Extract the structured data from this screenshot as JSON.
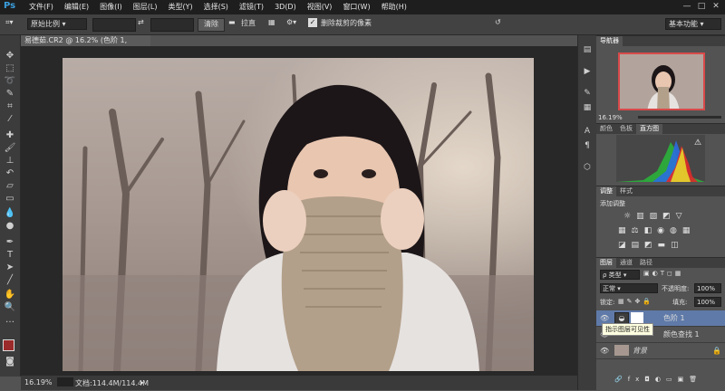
{
  "app": {
    "logo": "Ps"
  },
  "menu": [
    "文件(F)",
    "编辑(E)",
    "图像(I)",
    "图层(L)",
    "类型(Y)",
    "选择(S)",
    "滤镜(T)",
    "3D(D)",
    "视图(V)",
    "窗口(W)",
    "帮助(H)"
  ],
  "window_controls": [
    "—",
    "□",
    "✕"
  ],
  "options": {
    "ratio": "原始比例",
    "clear_button": "清除",
    "straighten": "拉直",
    "delete_cropped_label": "删除裁剪的像素",
    "workspace": "基本功能"
  },
  "document": {
    "tab_title": "易德茹.CR2 @ 16.2% (色阶 1, RGB/16) *",
    "zoom": "16.19%",
    "doc_info": "文档:114.4M/114.4M"
  },
  "navigator": {
    "tab": "导航器",
    "zoom": "16.19%"
  },
  "histogram": {
    "tabs": [
      "颜色",
      "色板",
      "直方图"
    ],
    "active": "直方图"
  },
  "adjustments": {
    "tabs": [
      "调整",
      "样式"
    ],
    "active": "调整",
    "title": "添加调整"
  },
  "layers": {
    "tabs": [
      "图层",
      "通道",
      "路径"
    ],
    "active": "图层",
    "filter_kind": "类型",
    "blend_mode": "正常",
    "opacity_label": "不透明度:",
    "opacity_value": "100%",
    "lock_label": "锁定:",
    "fill_label": "填充:",
    "fill_value": "100%",
    "items": [
      {
        "name": "色阶 1",
        "selected": true
      },
      {
        "name": "颜色查找 1",
        "selected": false
      },
      {
        "name": "背景",
        "selected": false
      }
    ],
    "tooltip": "指示图层可见性"
  },
  "colors": {
    "accent": "#3a9fdd",
    "foreground": "#9b2a2a",
    "background": "#ffffff"
  }
}
